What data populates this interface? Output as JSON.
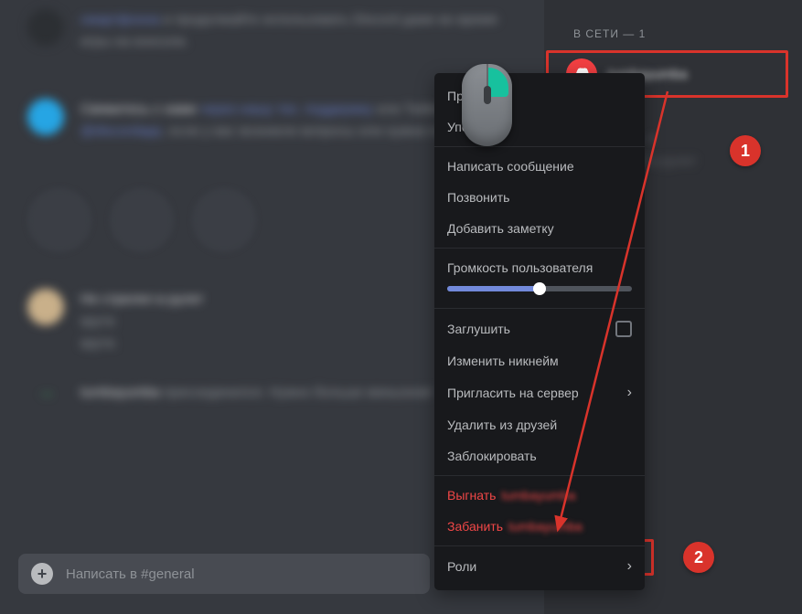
{
  "sidebar": {
    "online_header": "В СЕТИ — 1",
    "member_name": "tumbayumba",
    "offline_header": "НЕ В СЕТИ — 1",
    "offline_line": "Не стрелял в рулет"
  },
  "chat": {
    "msg1_part1": "смартфонна",
    "msg1_part2": " и продолжайте использовать Discord даже во время игры на консоли.",
    "msg2_part1": "Свяжитесь с нами",
    "msg2_link1": " через нашу тех. поддержку",
    "msg2_part2": " или Twitter ",
    "msg2_link2": "@discordapp",
    "msg2_part3": ", если у вас возникли вопросы или нужна помощь.",
    "msg3_user": "Не стрелял в рулет",
    "msg3_line1": "крута",
    "msg3_line2": "крута",
    "join_user": "tumbayumba",
    "join_text": " присоединился. Нужно больше миньонов!",
    "input_placeholder": "Написать в #general"
  },
  "context_menu": {
    "profile": "Профиль",
    "mention": "Упомянуть",
    "message": "Написать сообщение",
    "call": "Позвонить",
    "note": "Добавить заметку",
    "volume": "Громкость пользователя",
    "volume_pct": 50,
    "mute": "Заглушить",
    "nickname": "Изменить никнейм",
    "invite": "Пригласить на сервер",
    "remove_friend": "Удалить из друзей",
    "block": "Заблокировать",
    "kick": "Выгнать",
    "kick_target": "tumbayumba",
    "ban": "Забанить",
    "ban_target": "tumbayumba",
    "roles": "Роли"
  },
  "annotations": {
    "badge1": "1",
    "badge2": "2"
  }
}
